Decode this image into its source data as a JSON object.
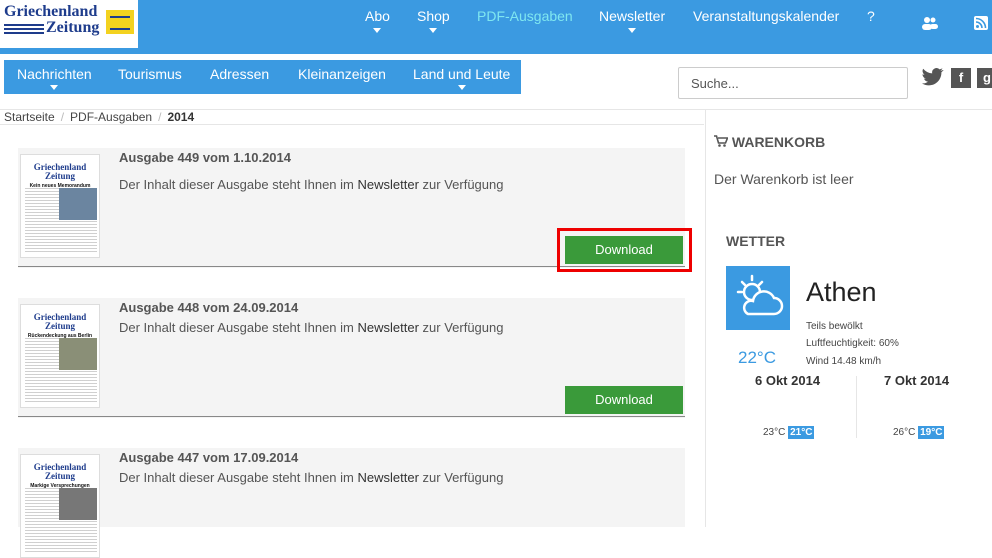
{
  "logo": {
    "line1": "Griechenland",
    "line2": "Zeitung"
  },
  "topnav": [
    {
      "label": "Abo",
      "caret": true
    },
    {
      "label": "Shop",
      "caret": true
    },
    {
      "label": "PDF-Ausgaben",
      "caret": false,
      "active": true
    },
    {
      "label": "Newsletter",
      "caret": true
    },
    {
      "label": "Veranstaltungskalender",
      "caret": false
    },
    {
      "label": "?",
      "caret": false
    }
  ],
  "subnav": [
    {
      "label": "Nachrichten",
      "caret": true
    },
    {
      "label": "Tourismus",
      "caret": false
    },
    {
      "label": "Adressen",
      "caret": false
    },
    {
      "label": "Kleinanzeigen",
      "caret": false
    },
    {
      "label": "Land und Leute",
      "caret": true
    }
  ],
  "search": {
    "placeholder": "Suche..."
  },
  "social": {
    "facebook": "f",
    "google": "g"
  },
  "breadcrumb": {
    "home": "Startseite",
    "section": "PDF-Ausgaben",
    "current": "2014"
  },
  "issues": [
    {
      "title": "Ausgabe 449 vom 1.10.2014",
      "desc_pre": "Der Inhalt dieser Ausgabe steht Ihnen im ",
      "desc_link": "Newsletter",
      "desc_post": " zur Verfügung",
      "download": "Download",
      "thumb_headline": "Kein neues Memorandum"
    },
    {
      "title": "Ausgabe 448 vom 24.09.2014",
      "desc_pre": "Der Inhalt dieser Ausgabe steht Ihnen im ",
      "desc_link": "Newsletter",
      "desc_post": " zur Verfügung",
      "download": "Download",
      "thumb_headline": "Rückendeckung aus Berlin"
    },
    {
      "title": "Ausgabe 447 vom 17.09.2014",
      "desc_pre": "Der Inhalt dieser Ausgabe steht Ihnen im ",
      "desc_link": "Newsletter",
      "desc_post": " zur Verfügung",
      "download": "Download",
      "thumb_headline": "Markige Versprechungen"
    }
  ],
  "cart": {
    "title": "WARENKORB",
    "empty": "Der Warenkorb ist leer"
  },
  "weather": {
    "title": "WETTER",
    "city": "Athen",
    "condition": "Teils bewölkt",
    "humidity": "Luftfeuchtigkeit: 60%",
    "wind": "Wind 14.48 km/h",
    "temp": "22°C",
    "forecast": [
      {
        "date": "6 Okt 2014",
        "low": "23°C",
        "high": "21°C"
      },
      {
        "date": "7 Okt 2014",
        "low": "26°C",
        "high": "19°C"
      }
    ]
  },
  "colors": {
    "brand_blue": "#3b9ae1",
    "download_green": "#3a9a3a",
    "highlight_red": "#e00000"
  }
}
